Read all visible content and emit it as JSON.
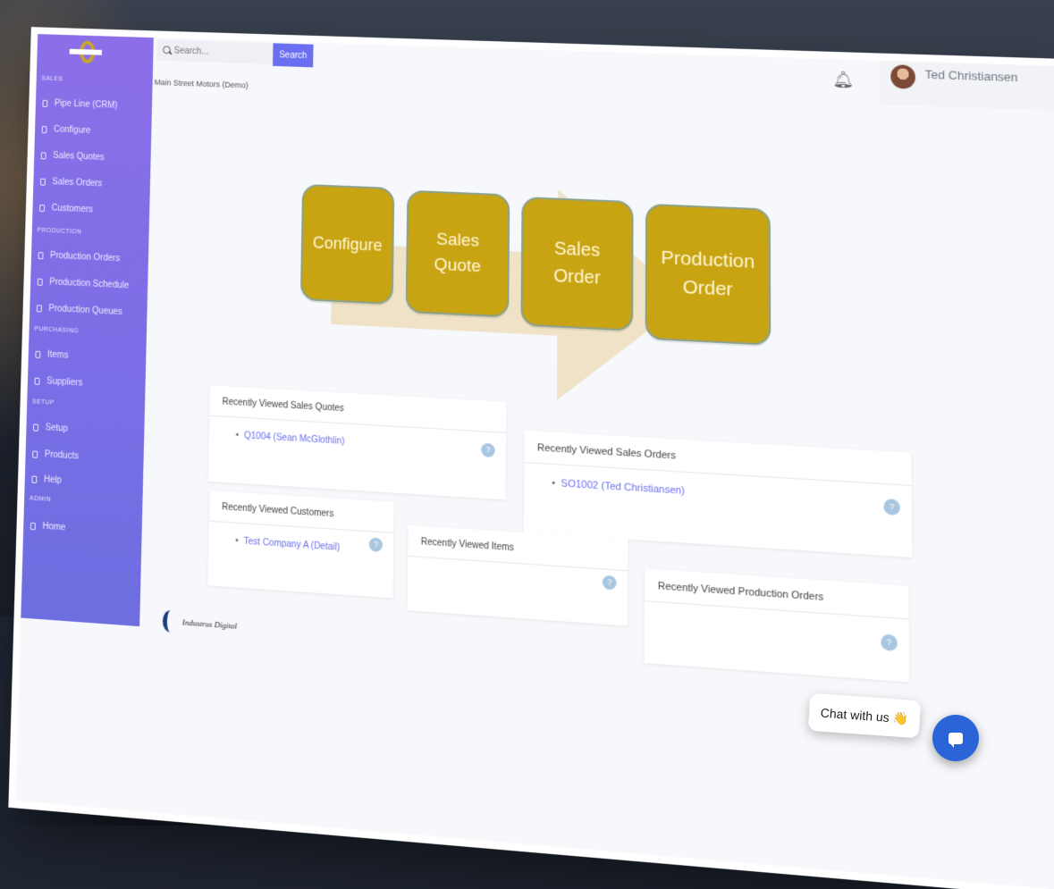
{
  "header": {
    "search_placeholder": "Search...",
    "search_button": "Search",
    "user_name": "Ted Christiansen",
    "company": "Main Street Motors (Demo)"
  },
  "sidebar": {
    "sections": {
      "sales": "SALES",
      "production": "PRODUCTION",
      "purchasing": "PURCHASING",
      "setup": "SETUP",
      "admin": "ADMIN"
    },
    "items": [
      {
        "label": "Pipe Line (CRM)"
      },
      {
        "label": "Configure"
      },
      {
        "label": "Sales Quotes"
      },
      {
        "label": "Sales Orders"
      },
      {
        "label": "Customers"
      },
      {
        "label": "Production Orders"
      },
      {
        "label": "Production Schedule"
      },
      {
        "label": "Production Queues"
      },
      {
        "label": "Items"
      },
      {
        "label": "Suppliers"
      },
      {
        "label": "Setup"
      },
      {
        "label": "Products"
      },
      {
        "label": "Help"
      },
      {
        "label": "Home"
      }
    ]
  },
  "diagram": {
    "steps": [
      {
        "line1": "Configure",
        "line2": ""
      },
      {
        "line1": "Sales",
        "line2": "Quote"
      },
      {
        "line1": "Sales",
        "line2": "Order"
      },
      {
        "line1": "Production",
        "line2": "Order"
      }
    ],
    "arrow_color": "#efe2c6",
    "box_color": "#c9a412"
  },
  "cards": {
    "quotes": {
      "title": "Recently Viewed Sales Quotes",
      "item": "Q1004 (Sean McGlothlin)"
    },
    "orders": {
      "title": "Recently Viewed Sales Orders",
      "item": "SO1002 (Ted Christiansen)"
    },
    "customers": {
      "title": "Recently Viewed Customers",
      "item": "Test Company A (Detail)"
    },
    "items": {
      "title": "Recently Viewed Items"
    },
    "production": {
      "title": "Recently Viewed Production Orders"
    },
    "help_glyph": "?"
  },
  "footer": {
    "brand": "Industrus Digital"
  },
  "chat": {
    "label": "Chat with us",
    "emoji": "👋"
  }
}
